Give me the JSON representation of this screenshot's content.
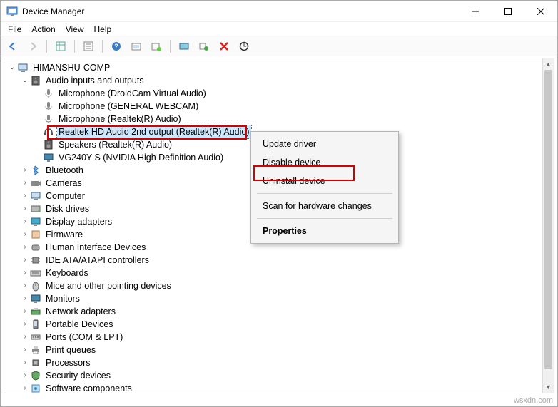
{
  "window": {
    "title": "Device Manager"
  },
  "menubar": [
    "File",
    "Action",
    "View",
    "Help"
  ],
  "toolbar_icons": [
    "back",
    "forward",
    "grid",
    "properties",
    "help",
    "calendar",
    "users",
    "monitor",
    "monitor-info",
    "delete",
    "scan"
  ],
  "root": "HIMANSHU-COMP",
  "audio_category": "Audio inputs and outputs",
  "audio_items": [
    "Microphone (DroidCam Virtual Audio)",
    "Microphone (GENERAL WEBCAM)",
    "Microphone (Realtek(R) Audio)",
    "Realtek HD Audio 2nd output (Realtek(R) Audio)",
    "Speakers (Realtek(R) Audio)",
    "VG240Y S (NVIDIA High Definition Audio)"
  ],
  "selected_device_index": 3,
  "categories": [
    "Bluetooth",
    "Cameras",
    "Computer",
    "Disk drives",
    "Display adapters",
    "Firmware",
    "Human Interface Devices",
    "IDE ATA/ATAPI controllers",
    "Keyboards",
    "Mice and other pointing devices",
    "Monitors",
    "Network adapters",
    "Portable Devices",
    "Ports (COM & LPT)",
    "Print queues",
    "Processors",
    "Security devices",
    "Software components"
  ],
  "context_menu": {
    "items": [
      {
        "label": "Update driver"
      },
      {
        "label": "Disable device"
      },
      {
        "label": "Uninstall device",
        "highlight": true
      },
      {
        "sep": true
      },
      {
        "label": "Scan for hardware changes"
      },
      {
        "sep": true
      },
      {
        "label": "Properties",
        "bold": true
      }
    ]
  },
  "watermark": "wsxdn.com"
}
